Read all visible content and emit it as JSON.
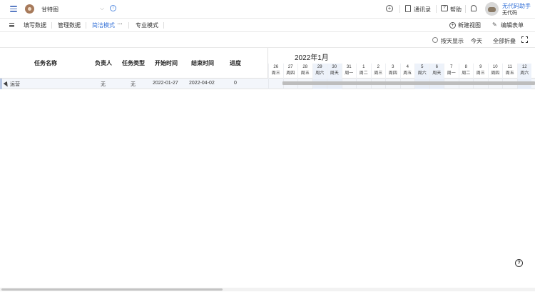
{
  "app": {
    "title": "甘特图",
    "user_name": "无代码助手",
    "user_org": "无代码"
  },
  "topbar": {
    "contacts_label": "通讯录",
    "help_label": "帮助"
  },
  "view_tabs": [
    {
      "label": "填写数据",
      "active": false
    },
    {
      "label": "管理数据",
      "active": false
    },
    {
      "label": "简洁模式",
      "active": true
    },
    {
      "label": "专业模式",
      "active": false
    }
  ],
  "view_actions": {
    "new_view": "新建视图",
    "edit_form": "编辑表单"
  },
  "toolbar": {
    "by_day": "按天显示",
    "today": "今天",
    "collapse_all": "全部折叠"
  },
  "columns": [
    "任务名称",
    "负责人",
    "任务类型",
    "开始时间",
    "结束时间",
    "进度"
  ],
  "gantt": {
    "month": "2022年1月",
    "days": [
      {
        "d": "26",
        "w": "周三",
        "weekend": false
      },
      {
        "d": "27",
        "w": "周四",
        "weekend": false
      },
      {
        "d": "28",
        "w": "周五",
        "weekend": false
      },
      {
        "d": "29",
        "w": "周六",
        "weekend": true
      },
      {
        "d": "30",
        "w": "周天",
        "weekend": true
      },
      {
        "d": "31",
        "w": "周一",
        "weekend": false
      },
      {
        "d": "1",
        "w": "周二",
        "weekend": false
      },
      {
        "d": "2",
        "w": "周三",
        "weekend": false
      },
      {
        "d": "3",
        "w": "周四",
        "weekend": false
      },
      {
        "d": "4",
        "w": "周五",
        "weekend": false
      },
      {
        "d": "5",
        "w": "周六",
        "weekend": true
      },
      {
        "d": "6",
        "w": "周天",
        "weekend": true
      },
      {
        "d": "7",
        "w": "周一",
        "weekend": false
      },
      {
        "d": "8",
        "w": "周二",
        "weekend": false
      },
      {
        "d": "9",
        "w": "周三",
        "weekend": false
      },
      {
        "d": "10",
        "w": "周四",
        "weekend": false
      },
      {
        "d": "11",
        "w": "周五",
        "weekend": false
      },
      {
        "d": "12",
        "w": "周六",
        "weekend": true
      }
    ]
  },
  "rows": [
    {
      "name": "运营",
      "owner": "无",
      "type": "无",
      "start": "2022-01-27",
      "end": "2022-04-02",
      "progress": "0"
    }
  ]
}
